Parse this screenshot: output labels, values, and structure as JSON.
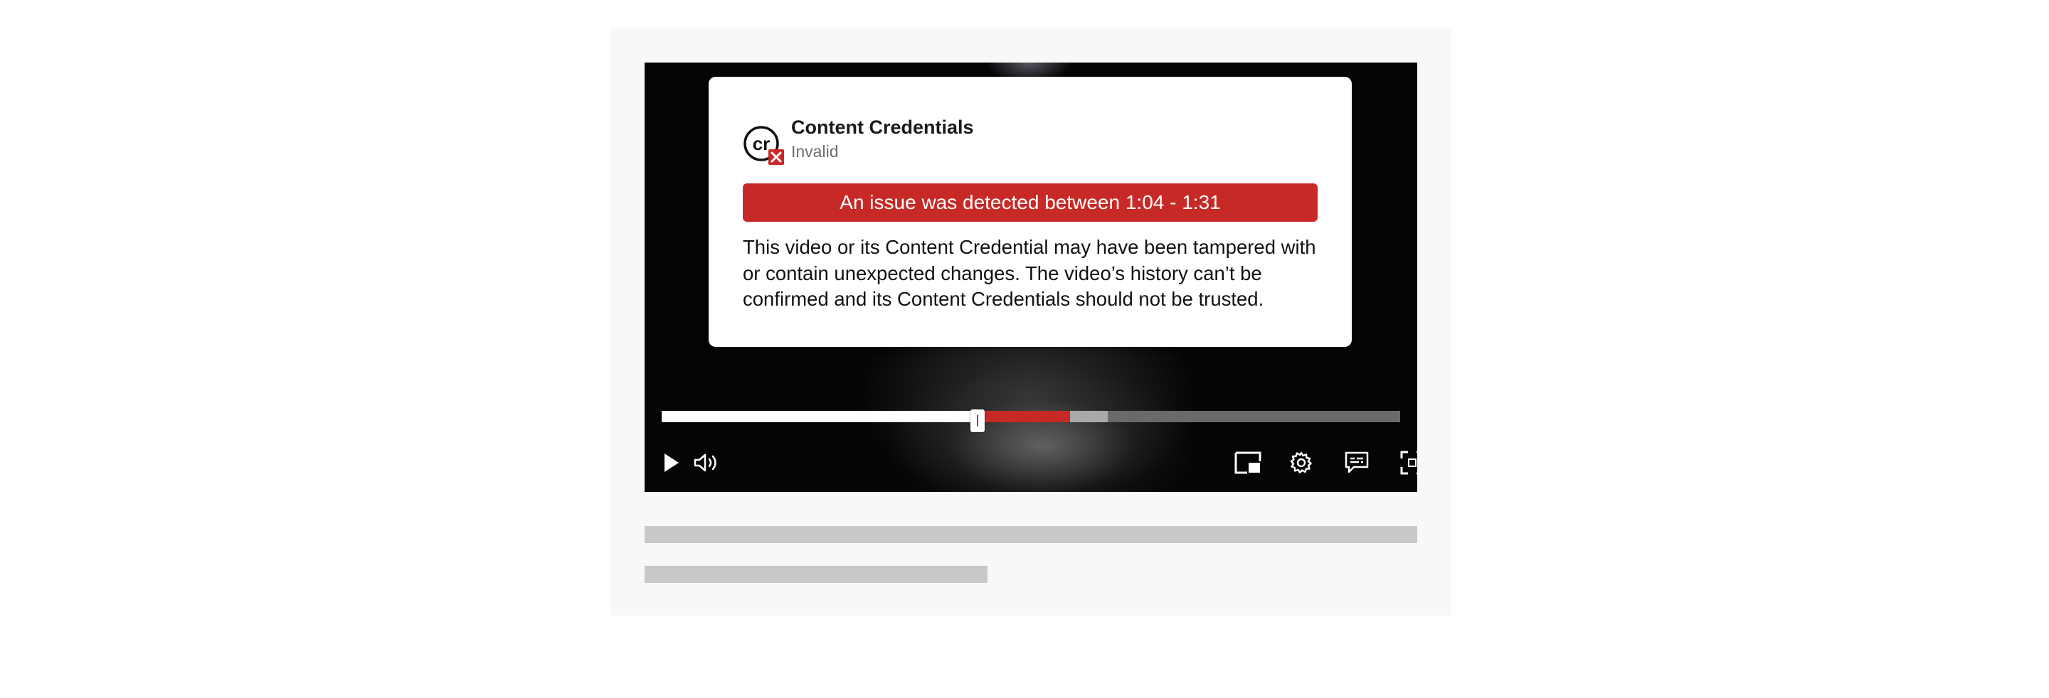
{
  "popup": {
    "title": "Content Credentials",
    "status": "Invalid",
    "issue_banner": "An issue was detected between 1:04 - 1:31",
    "description": "This video or its Content Credential may have been tampered with or contain unexpected changes. The video’s history can’t be confirmed and its Content Credentials should not be trusted.",
    "logo_text": "cr",
    "logo_icon": "content-credentials-invalid-icon"
  },
  "player": {
    "progress": {
      "played_fraction": 0.428,
      "issue_start_fraction": 0.428,
      "issue_end_fraction": 0.553,
      "buffered_end_fraction": 0.604
    },
    "controls": {
      "left": [
        "play-icon",
        "volume-icon"
      ],
      "right": [
        "picture-in-picture-icon",
        "settings-icon",
        "captions-icon",
        "fullscreen-icon"
      ]
    }
  },
  "colors": {
    "accent_red": "#c72a26",
    "track": "#6a6a6a",
    "played": "#ffffff",
    "buffered": "#a9a9a9",
    "placeholder": "#c8c8c8"
  }
}
